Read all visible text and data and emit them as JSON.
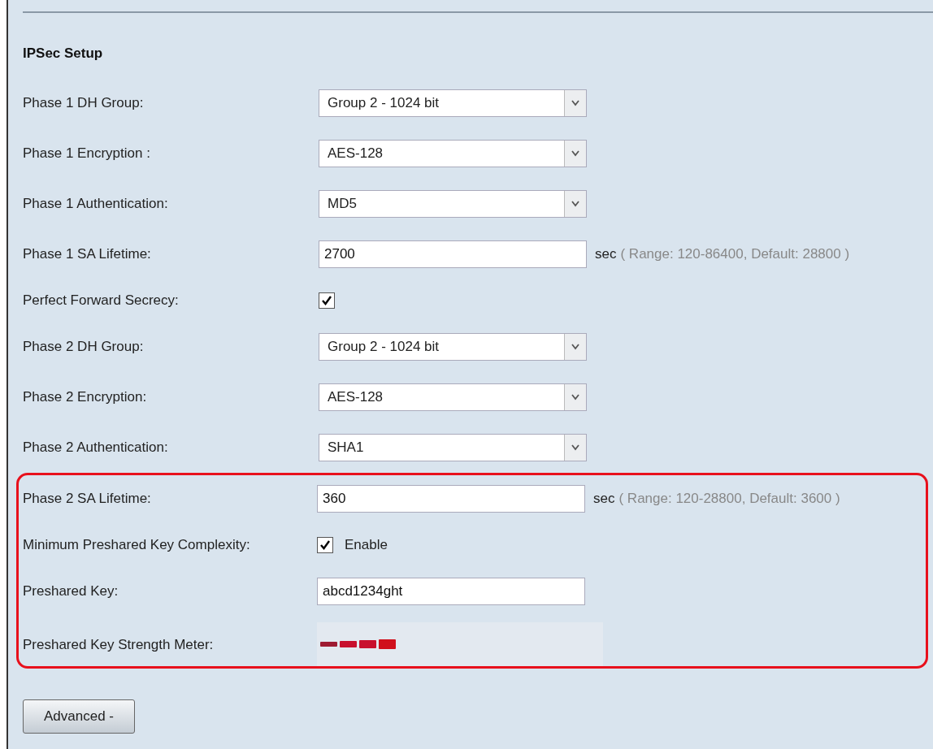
{
  "section_title": "IPSec Setup",
  "fields": [
    {
      "kind": "select",
      "label": "Phase 1 DH Group:",
      "value": "Group 2 - 1024 bit"
    },
    {
      "kind": "select",
      "label": "Phase 1 Encryption :",
      "value": "AES-128"
    },
    {
      "kind": "select",
      "label": "Phase 1 Authentication:",
      "value": "MD5"
    },
    {
      "kind": "text",
      "label": "Phase 1 SA Lifetime:",
      "value": "2700",
      "unit": "sec",
      "hint": "( Range: 120-86400, Default: 28800 )"
    },
    {
      "kind": "checkbox",
      "label": "Perfect Forward Secrecy:",
      "checked": true
    },
    {
      "kind": "select",
      "label": "Phase 2 DH Group:",
      "value": "Group 2 - 1024 bit"
    },
    {
      "kind": "select",
      "label": "Phase 2 Encryption:",
      "value": "AES-128"
    },
    {
      "kind": "select",
      "label": "Phase 2 Authentication:",
      "value": "SHA1"
    }
  ],
  "highlighted_fields": [
    {
      "kind": "text",
      "label": "Phase 2 SA Lifetime:",
      "value": "360",
      "unit": "sec",
      "hint": "( Range: 120-28800, Default: 3600 )"
    },
    {
      "kind": "checkbox",
      "label": "Minimum Preshared Key Complexity:",
      "checked": true,
      "option": "Enable"
    },
    {
      "kind": "text",
      "label": "Preshared Key:",
      "value": "abcd1234ght"
    },
    {
      "kind": "meter",
      "label": "Preshared Key Strength Meter:",
      "segments": [
        {
          "color": "#9e1b32"
        },
        {
          "color": "#c8102e"
        },
        {
          "color": "#c8102e"
        },
        {
          "color": "#d0101c"
        }
      ]
    }
  ],
  "advanced_button": "Advanced -"
}
